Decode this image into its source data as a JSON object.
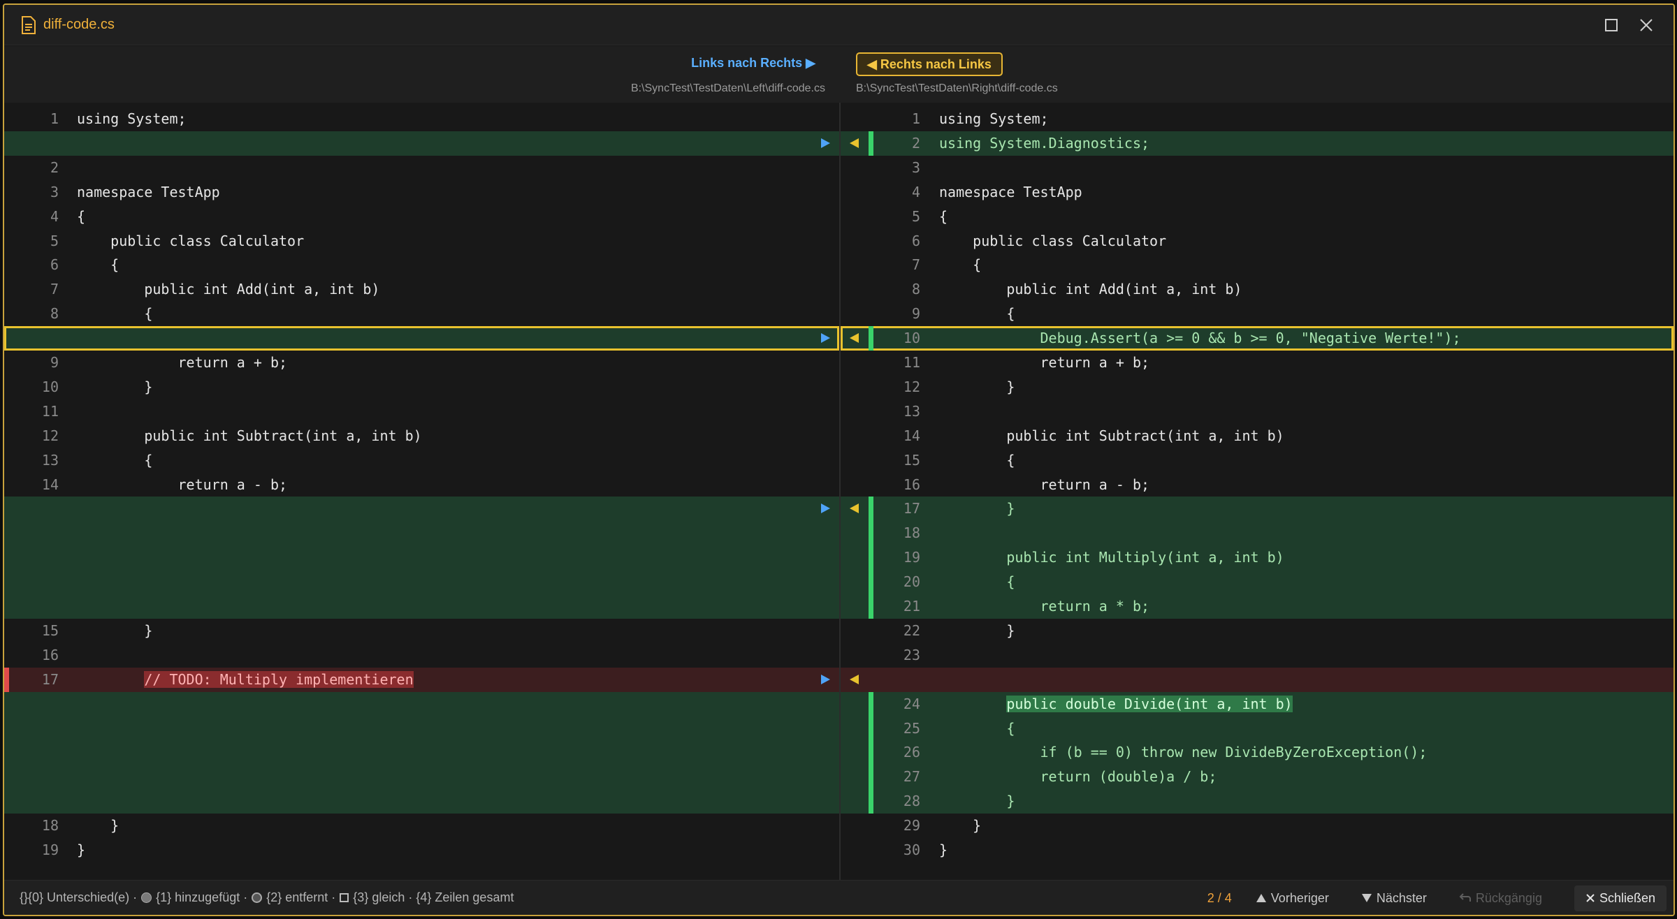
{
  "window": {
    "title": "diff-code.cs"
  },
  "header": {
    "copy_left_to_right": "Links nach Rechts ▶",
    "copy_right_to_left": "◀ Rechts nach Links",
    "left_path": "B:\\SyncTest\\TestDaten\\Left\\diff-code.cs",
    "right_path": "B:\\SyncTest\\TestDaten\\Right\\diff-code.cs"
  },
  "left": {
    "lines": [
      {
        "n": "1",
        "t": "using System;"
      },
      {
        "n": "",
        "t": ""
      },
      {
        "n": "2",
        "t": ""
      },
      {
        "n": "3",
        "t": "namespace TestApp"
      },
      {
        "n": "4",
        "t": "{"
      },
      {
        "n": "5",
        "t": "    public class Calculator"
      },
      {
        "n": "6",
        "t": "    {"
      },
      {
        "n": "7",
        "t": "        public int Add(int a, int b)"
      },
      {
        "n": "8",
        "t": "        {"
      },
      {
        "n": "",
        "t": ""
      },
      {
        "n": "9",
        "t": "            return a + b;"
      },
      {
        "n": "10",
        "t": "        }"
      },
      {
        "n": "11",
        "t": ""
      },
      {
        "n": "12",
        "t": "        public int Subtract(int a, int b)"
      },
      {
        "n": "13",
        "t": "        {"
      },
      {
        "n": "14",
        "t": "            return a - b;"
      },
      {
        "n": "",
        "t": ""
      },
      {
        "n": "",
        "t": ""
      },
      {
        "n": "",
        "t": ""
      },
      {
        "n": "",
        "t": ""
      },
      {
        "n": "",
        "t": ""
      },
      {
        "n": "15",
        "t": "        }"
      },
      {
        "n": "16",
        "t": ""
      },
      {
        "n": "17",
        "t": "        // TODO: Multiply implementieren"
      },
      {
        "n": "",
        "t": ""
      },
      {
        "n": "",
        "t": ""
      },
      {
        "n": "",
        "t": ""
      },
      {
        "n": "",
        "t": ""
      },
      {
        "n": "",
        "t": ""
      },
      {
        "n": "18",
        "t": "    }"
      },
      {
        "n": "19",
        "t": "}"
      }
    ]
  },
  "right": {
    "lines": [
      {
        "n": "1",
        "t": "using System;"
      },
      {
        "n": "2",
        "t": "using System.Diagnostics;"
      },
      {
        "n": "3",
        "t": ""
      },
      {
        "n": "4",
        "t": "namespace TestApp"
      },
      {
        "n": "5",
        "t": "{"
      },
      {
        "n": "6",
        "t": "    public class Calculator"
      },
      {
        "n": "7",
        "t": "    {"
      },
      {
        "n": "8",
        "t": "        public int Add(int a, int b)"
      },
      {
        "n": "9",
        "t": "        {"
      },
      {
        "n": "10",
        "t": "            Debug.Assert(a >= 0 && b >= 0, \"Negative Werte!\");"
      },
      {
        "n": "11",
        "t": "            return a + b;"
      },
      {
        "n": "12",
        "t": "        }"
      },
      {
        "n": "13",
        "t": ""
      },
      {
        "n": "14",
        "t": "        public int Subtract(int a, int b)"
      },
      {
        "n": "15",
        "t": "        {"
      },
      {
        "n": "16",
        "t": "            return a - b;"
      },
      {
        "n": "17",
        "t": "        }"
      },
      {
        "n": "18",
        "t": ""
      },
      {
        "n": "19",
        "t": "        public int Multiply(int a, int b)"
      },
      {
        "n": "20",
        "t": "        {"
      },
      {
        "n": "21",
        "t": "            return a * b;"
      },
      {
        "n": "22",
        "t": "        }"
      },
      {
        "n": "23",
        "t": ""
      },
      {
        "n": "",
        "t": ""
      },
      {
        "n": "24",
        "t": "        public double Divide(int a, int b)"
      },
      {
        "n": "25",
        "t": "        {"
      },
      {
        "n": "26",
        "t": "            if (b == 0) throw new DivideByZeroException();"
      },
      {
        "n": "27",
        "t": "            return (double)a / b;"
      },
      {
        "n": "28",
        "t": "        }"
      },
      {
        "n": "29",
        "t": "    }"
      },
      {
        "n": "30",
        "t": "}"
      }
    ]
  },
  "status": {
    "legend_diff": "{}{0} Unterschied(e) ·",
    "legend_added": "{1} hinzugefügt ·",
    "legend_removed": "{2} entfernt ·",
    "legend_equal": "{3} gleich · {4} Zeilen gesamt",
    "counter": "2 / 4",
    "prev": "Vorheriger",
    "next": "Nächster",
    "undo": "Rückgängig",
    "close": "Schließen"
  },
  "colors": {
    "accent": "#f0b13a",
    "added_bg": "#1e3d2b",
    "removed_bg": "#3c1e1f",
    "added_marker": "#3ad36a",
    "removed_marker": "#e24b4b",
    "arrow_blue": "#4fa3f7",
    "arrow_yellow": "#e8c22e"
  }
}
